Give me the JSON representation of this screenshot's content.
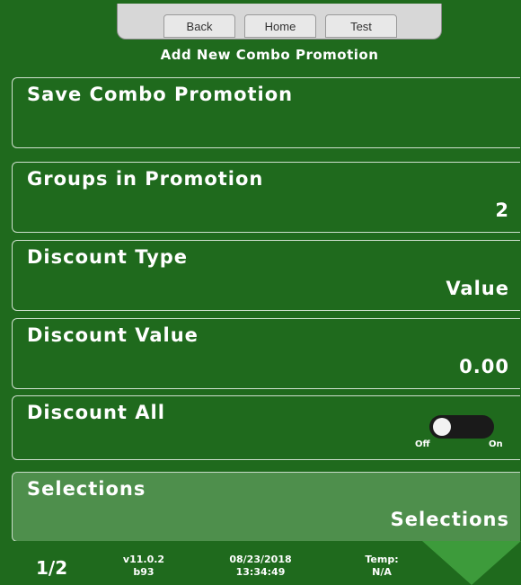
{
  "nav": {
    "back": "Back",
    "home": "Home",
    "test": "Test"
  },
  "page_title": "Add New Combo Promotion",
  "rows": {
    "save": {
      "label": "Save Combo Promotion"
    },
    "groups": {
      "label": "Groups in Promotion",
      "value": "2"
    },
    "discount_type": {
      "label": "Discount Type",
      "value": "Value"
    },
    "discount_value": {
      "label": "Discount Value",
      "value": "0.00"
    },
    "discount_all": {
      "label": "Discount All",
      "toggle_state": "off",
      "off_label": "Off",
      "on_label": "On"
    },
    "selections": {
      "label": "Selections",
      "value": "Selections"
    }
  },
  "footer": {
    "page": "1/2",
    "version_line1": "v11.0.2",
    "version_line2": "b93",
    "date": "08/23/2018",
    "time": "13:34:49",
    "temp_label": "Temp:",
    "temp_value": "N/A"
  },
  "colors": {
    "background": "#1f6a1d",
    "highlight_row": "#4e8f4c",
    "arrow": "#3d9b3b"
  }
}
